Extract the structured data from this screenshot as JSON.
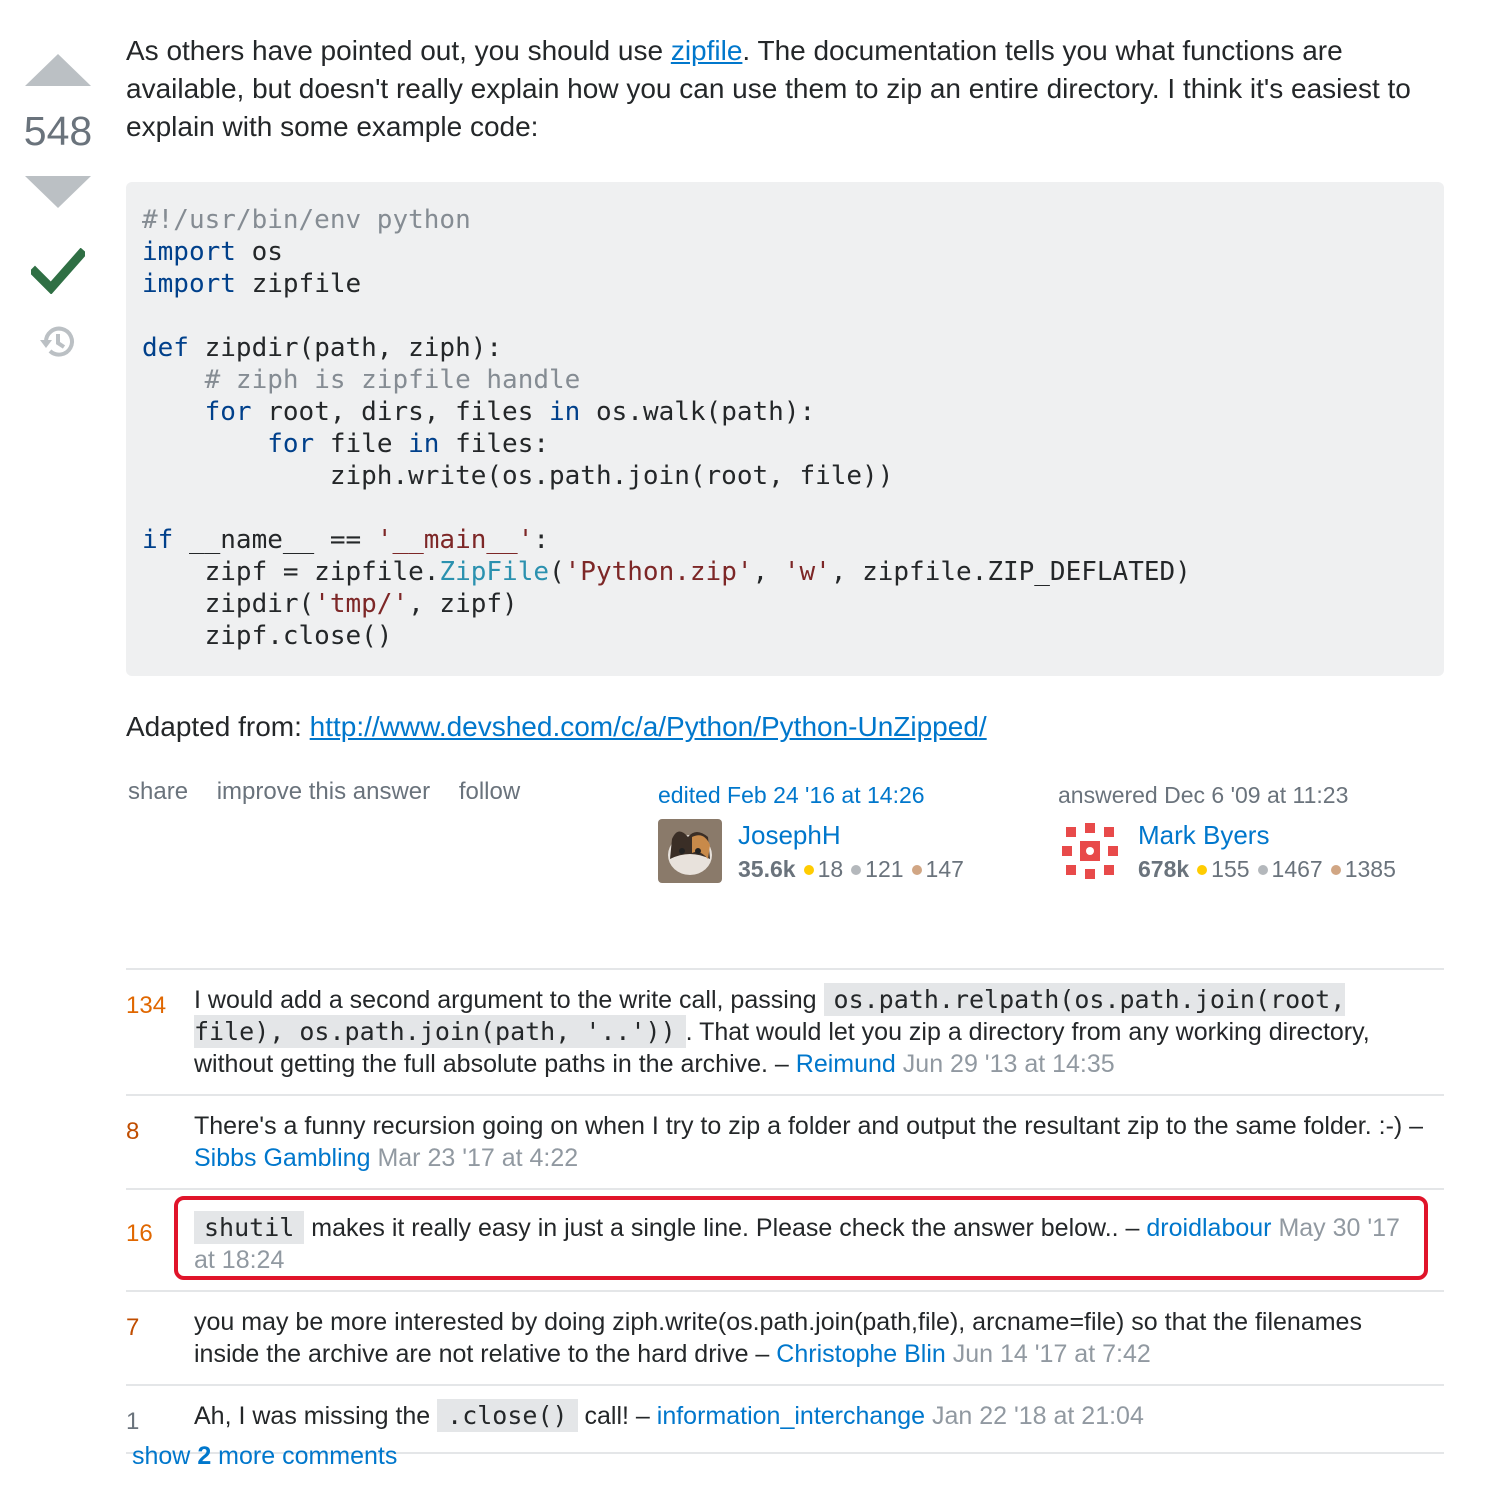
{
  "vote": {
    "count": "548"
  },
  "answer": {
    "intro_before": "As others have pointed out, you should use ",
    "intro_link": "zipfile",
    "intro_after": ". The documentation tells you what functions are available, but doesn't really explain how you can use them to zip an entire directory. I think it's easiest to explain with some example code:",
    "adapted_label": "Adapted from: ",
    "adapted_link": "http://www.devshed.com/c/a/Python/Python-UnZipped/"
  },
  "menu": {
    "share": "share",
    "improve": "improve this answer",
    "follow": "follow"
  },
  "editor": {
    "action": "edited Feb 24 '16 at 14:26",
    "name": "JosephH",
    "rep": "35.6k",
    "gold": "18",
    "silver": "121",
    "bronze": "147"
  },
  "author": {
    "action": "answered Dec 6 '09 at 11:23",
    "name": "Mark Byers",
    "rep": "678k",
    "gold": "155",
    "silver": "1467",
    "bronze": "1385"
  },
  "comments": [
    {
      "score": "134",
      "before": "I would add a second argument to the write call, passing ",
      "code": "os.path.relpath(os.path.join(root, file), os.path.join(path, '..'))",
      "after": ". That would let you zip a directory from any working directory, without getting the full absolute paths in the archive. – ",
      "user": "Reimund",
      "date": "Jun 29 '13 at 14:35"
    },
    {
      "score": "8",
      "before": "There's a funny recursion going on when I try to zip a folder and output the resultant zip to the same folder. :-) – ",
      "user": "Sibbs Gambling",
      "date": "Mar 23 '17 at 4:22"
    },
    {
      "score": "16",
      "code": "shutil",
      "after": " makes it really easy in just a single line. Please check the answer below.. – ",
      "user": "droidlabour",
      "date": "May 30 '17 at 18:24"
    },
    {
      "score": "7",
      "before": "you may be more interested by doing ziph.write(os.path.join(path,file), arcname=file) so that the filenames inside the archive are not relative to the hard drive – ",
      "user": "Christophe Blin",
      "date": "Jun 14 '17 at 7:42"
    },
    {
      "score": "1",
      "before": "Ah, I was missing the ",
      "code": ".close()",
      "after": " call! – ",
      "user": "information_interchange",
      "date": "Jan 22 '18 at 21:04"
    }
  ],
  "more_comments": {
    "prefix": "show ",
    "count": "2",
    "suffix": " more comments"
  },
  "colors": {
    "accent": "#0077cc",
    "highlight_box": "#e0142a",
    "accepted": "#2f6f44"
  },
  "icons": [
    "arrow-up-icon",
    "arrow-down-icon",
    "accepted-check-icon",
    "history-icon"
  ]
}
